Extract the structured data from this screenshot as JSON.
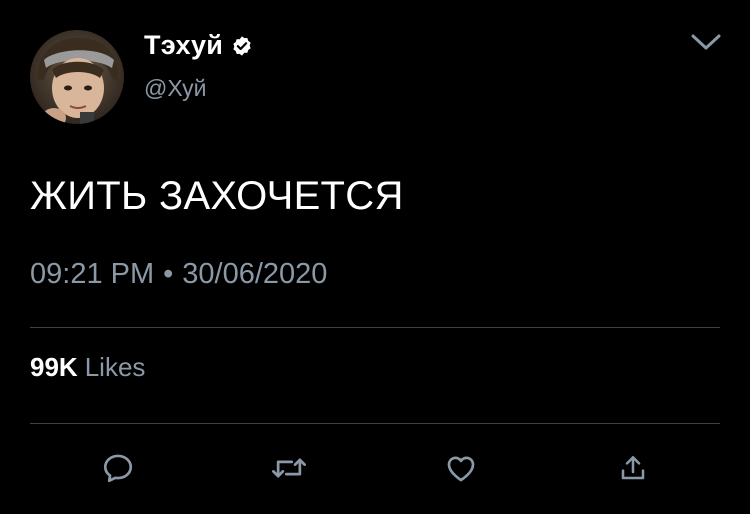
{
  "tweet": {
    "author": {
      "display_name": "Тэхуй",
      "handle": "@Хуй",
      "verified": true
    },
    "text": "ЖИТЬ ЗАХОЧЕТСЯ",
    "time": "09:21 PM",
    "separator": "•",
    "date": "30/06/2020",
    "likes_count": "99K",
    "likes_label": "Likes"
  },
  "actions": [
    {
      "name": "reply",
      "icon": "speech-bubble-icon"
    },
    {
      "name": "retweet",
      "icon": "retweet-arrows-icon"
    },
    {
      "name": "like",
      "icon": "heart-icon"
    },
    {
      "name": "share",
      "icon": "share-upload-icon"
    }
  ],
  "menu": {
    "icon": "chevron-down-icon"
  },
  "colors": {
    "background": "#000000",
    "primary_text": "#ffffff",
    "secondary_text": "#8b98a5",
    "divider": "#38444d",
    "icon": "#8b98a5",
    "verified_badge": "#ffffff"
  }
}
